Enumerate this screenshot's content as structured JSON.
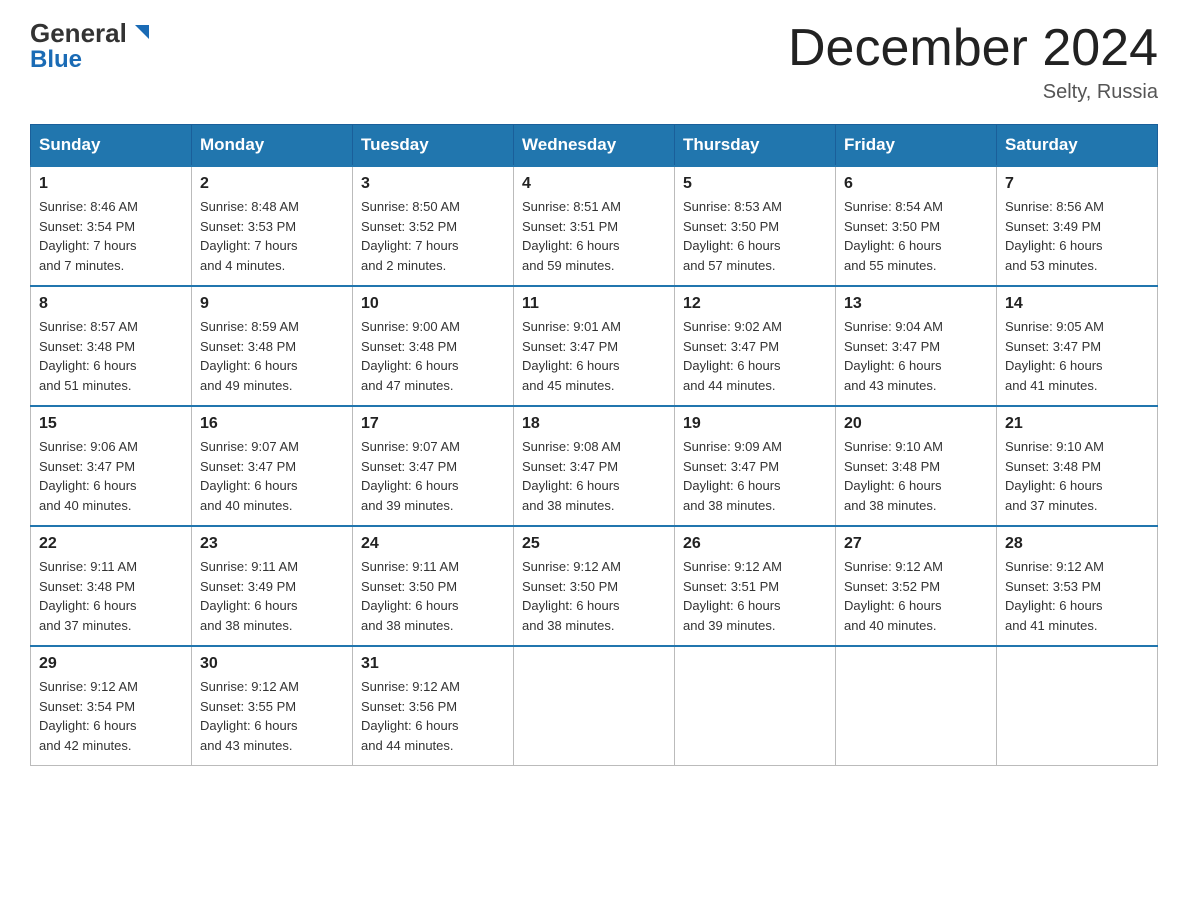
{
  "header": {
    "logo_general": "General",
    "logo_blue": "Blue",
    "month_title": "December 2024",
    "location": "Selty, Russia"
  },
  "days_of_week": [
    "Sunday",
    "Monday",
    "Tuesday",
    "Wednesday",
    "Thursday",
    "Friday",
    "Saturday"
  ],
  "weeks": [
    [
      {
        "day": "1",
        "sunrise": "8:46 AM",
        "sunset": "3:54 PM",
        "daylight": "7 hours and 7 minutes."
      },
      {
        "day": "2",
        "sunrise": "8:48 AM",
        "sunset": "3:53 PM",
        "daylight": "7 hours and 4 minutes."
      },
      {
        "day": "3",
        "sunrise": "8:50 AM",
        "sunset": "3:52 PM",
        "daylight": "7 hours and 2 minutes."
      },
      {
        "day": "4",
        "sunrise": "8:51 AM",
        "sunset": "3:51 PM",
        "daylight": "6 hours and 59 minutes."
      },
      {
        "day": "5",
        "sunrise": "8:53 AM",
        "sunset": "3:50 PM",
        "daylight": "6 hours and 57 minutes."
      },
      {
        "day": "6",
        "sunrise": "8:54 AM",
        "sunset": "3:50 PM",
        "daylight": "6 hours and 55 minutes."
      },
      {
        "day": "7",
        "sunrise": "8:56 AM",
        "sunset": "3:49 PM",
        "daylight": "6 hours and 53 minutes."
      }
    ],
    [
      {
        "day": "8",
        "sunrise": "8:57 AM",
        "sunset": "3:48 PM",
        "daylight": "6 hours and 51 minutes."
      },
      {
        "day": "9",
        "sunrise": "8:59 AM",
        "sunset": "3:48 PM",
        "daylight": "6 hours and 49 minutes."
      },
      {
        "day": "10",
        "sunrise": "9:00 AM",
        "sunset": "3:48 PM",
        "daylight": "6 hours and 47 minutes."
      },
      {
        "day": "11",
        "sunrise": "9:01 AM",
        "sunset": "3:47 PM",
        "daylight": "6 hours and 45 minutes."
      },
      {
        "day": "12",
        "sunrise": "9:02 AM",
        "sunset": "3:47 PM",
        "daylight": "6 hours and 44 minutes."
      },
      {
        "day": "13",
        "sunrise": "9:04 AM",
        "sunset": "3:47 PM",
        "daylight": "6 hours and 43 minutes."
      },
      {
        "day": "14",
        "sunrise": "9:05 AM",
        "sunset": "3:47 PM",
        "daylight": "6 hours and 41 minutes."
      }
    ],
    [
      {
        "day": "15",
        "sunrise": "9:06 AM",
        "sunset": "3:47 PM",
        "daylight": "6 hours and 40 minutes."
      },
      {
        "day": "16",
        "sunrise": "9:07 AM",
        "sunset": "3:47 PM",
        "daylight": "6 hours and 40 minutes."
      },
      {
        "day": "17",
        "sunrise": "9:07 AM",
        "sunset": "3:47 PM",
        "daylight": "6 hours and 39 minutes."
      },
      {
        "day": "18",
        "sunrise": "9:08 AM",
        "sunset": "3:47 PM",
        "daylight": "6 hours and 38 minutes."
      },
      {
        "day": "19",
        "sunrise": "9:09 AM",
        "sunset": "3:47 PM",
        "daylight": "6 hours and 38 minutes."
      },
      {
        "day": "20",
        "sunrise": "9:10 AM",
        "sunset": "3:48 PM",
        "daylight": "6 hours and 38 minutes."
      },
      {
        "day": "21",
        "sunrise": "9:10 AM",
        "sunset": "3:48 PM",
        "daylight": "6 hours and 37 minutes."
      }
    ],
    [
      {
        "day": "22",
        "sunrise": "9:11 AM",
        "sunset": "3:48 PM",
        "daylight": "6 hours and 37 minutes."
      },
      {
        "day": "23",
        "sunrise": "9:11 AM",
        "sunset": "3:49 PM",
        "daylight": "6 hours and 38 minutes."
      },
      {
        "day": "24",
        "sunrise": "9:11 AM",
        "sunset": "3:50 PM",
        "daylight": "6 hours and 38 minutes."
      },
      {
        "day": "25",
        "sunrise": "9:12 AM",
        "sunset": "3:50 PM",
        "daylight": "6 hours and 38 minutes."
      },
      {
        "day": "26",
        "sunrise": "9:12 AM",
        "sunset": "3:51 PM",
        "daylight": "6 hours and 39 minutes."
      },
      {
        "day": "27",
        "sunrise": "9:12 AM",
        "sunset": "3:52 PM",
        "daylight": "6 hours and 40 minutes."
      },
      {
        "day": "28",
        "sunrise": "9:12 AM",
        "sunset": "3:53 PM",
        "daylight": "6 hours and 41 minutes."
      }
    ],
    [
      {
        "day": "29",
        "sunrise": "9:12 AM",
        "sunset": "3:54 PM",
        "daylight": "6 hours and 42 minutes."
      },
      {
        "day": "30",
        "sunrise": "9:12 AM",
        "sunset": "3:55 PM",
        "daylight": "6 hours and 43 minutes."
      },
      {
        "day": "31",
        "sunrise": "9:12 AM",
        "sunset": "3:56 PM",
        "daylight": "6 hours and 44 minutes."
      },
      null,
      null,
      null,
      null
    ]
  ]
}
